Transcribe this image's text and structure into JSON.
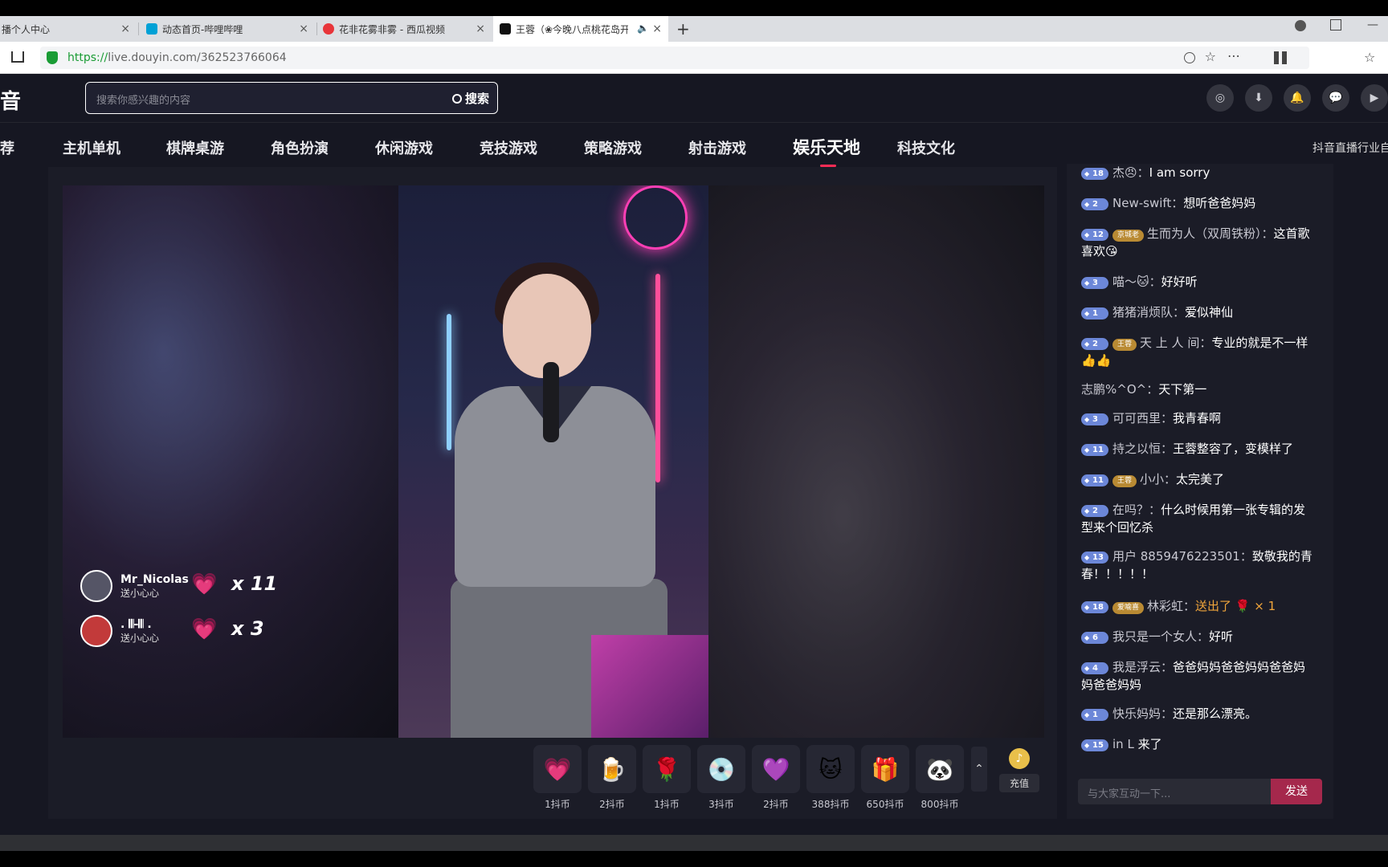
{
  "browser": {
    "tabs": [
      {
        "title": "播个人中心",
        "close": "×"
      },
      {
        "title": "动态首页-哔哩哔哩",
        "close": "×"
      },
      {
        "title": "花非花雾非雾 - 西瓜视频",
        "close": "×"
      },
      {
        "title": "王蓉（❀今晚八点桃花岛开",
        "close": "×",
        "audio": "🔈"
      }
    ],
    "new_tab": "+",
    "url_scheme": "https://",
    "url_rest": "live.douyin.com/362523766064",
    "window_min": "—"
  },
  "header": {
    "logo": "抖音",
    "search_placeholder": "搜索你感兴趣的内容",
    "search_button": "搜索"
  },
  "categories": [
    "荐",
    "主机单机",
    "棋牌桌游",
    "角色扮演",
    "休闲游戏",
    "竞技游戏",
    "策略游戏",
    "射击游戏",
    "娱乐天地",
    "科技文化"
  ],
  "categories_tail": "抖音直播行业自",
  "gift_notices": [
    {
      "name": "Mr_Nicolas",
      "sub": "送小心心",
      "count": "x 11"
    },
    {
      "name": ". 𝄃𝄃-𝄃𝄃 .",
      "sub": "送小心心",
      "count": "x 3"
    }
  ],
  "gifts": [
    {
      "icon": "💗",
      "price": "1抖币"
    },
    {
      "icon": "🍺",
      "price": "2抖币"
    },
    {
      "icon": "🌹",
      "price": "1抖币"
    },
    {
      "icon": "💿",
      "price": "3抖币"
    },
    {
      "icon": "💜",
      "price": "2抖币"
    },
    {
      "icon": "🐱",
      "price": "388抖币"
    },
    {
      "icon": "🎁",
      "price": "650抖币"
    },
    {
      "icon": "🐼",
      "price": "800抖币"
    }
  ],
  "more_gifts": "⌃",
  "recharge": {
    "icon": "♪",
    "label": "充值"
  },
  "chat": {
    "messages": [
      {
        "level": "18",
        "user": "杰😠：",
        "text": "I am sorry"
      },
      {
        "level": "2",
        "user": "New-swift：",
        "text": "想听爸爸妈妈"
      },
      {
        "level": "12",
        "fan": "京城老",
        "user": "生而为人（双周铁粉）：",
        "text": "这首歌喜欢😘"
      },
      {
        "level": "3",
        "user": "喵～🐱：",
        "text": "好好听"
      },
      {
        "level": "1",
        "user": "猪猪消烦队：",
        "text": "爱似神仙"
      },
      {
        "level": "2",
        "fan": "王蓉",
        "user": "天 上 人 间：",
        "text": "专业的就是不一样 👍👍"
      },
      {
        "user": "志鹏%^O^：",
        "text": "天下第一"
      },
      {
        "level": "3",
        "user": "可可西里：",
        "text": "我青春啊"
      },
      {
        "level": "11",
        "user": "持之以恒：",
        "text": "王蓉整容了，变模样了"
      },
      {
        "level": "11",
        "fan": "王蓉",
        "user": "小小：",
        "text": "太完美了"
      },
      {
        "level": "2",
        "user": "在吗？：",
        "text": "什么时候用第一张专辑的发型来个回忆杀"
      },
      {
        "level": "13",
        "user": "用户 8859476223501：",
        "text": "致敬我的青春！！！！！"
      },
      {
        "level": "18",
        "fan": "爱喻喜",
        "user": "林彩虹：",
        "text": "送出了 🌹 × 1"
      },
      {
        "level": "6",
        "user": "我只是一个女人：",
        "text": "好听"
      },
      {
        "level": "4",
        "user": "我是浮云：",
        "text": "爸爸妈妈爸爸妈妈爸爸妈妈爸爸妈妈"
      },
      {
        "level": "1",
        "user": "快乐妈妈：",
        "text": "还是那么漂亮。"
      },
      {
        "level": "15",
        "user": "in L",
        "text": "来了"
      }
    ],
    "input_placeholder": "与大家互动一下...",
    "send_label": "发送"
  },
  "colors": {
    "accent": "#fe2c55",
    "send": "#a5284c",
    "level_badge": "#6c87d8",
    "fan_badge": "#b98a33"
  }
}
